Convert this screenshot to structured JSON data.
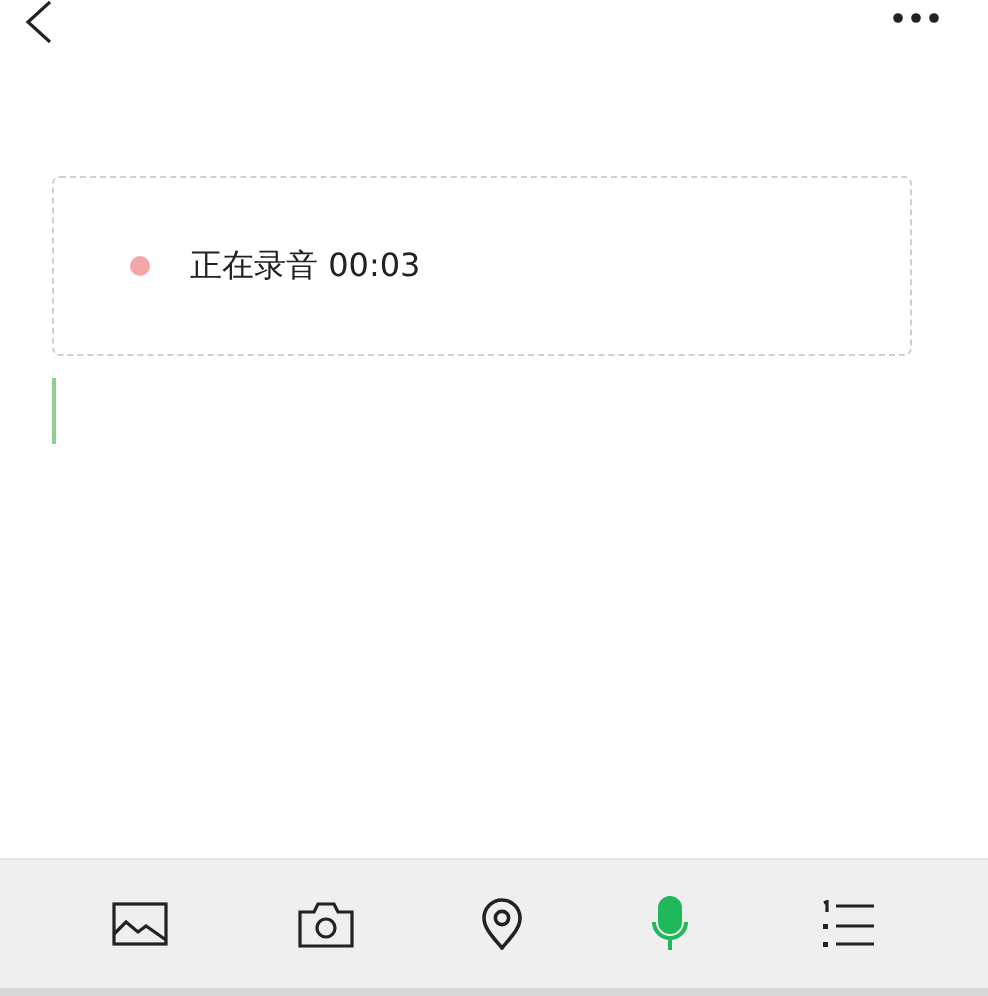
{
  "recording": {
    "label": "正在录音 00:03",
    "color": "#f4a7a9"
  },
  "toolbar": [
    {
      "kind": "image",
      "selected": false
    },
    {
      "kind": "camera",
      "selected": false
    },
    {
      "kind": "location",
      "selected": false
    },
    {
      "kind": "mic",
      "selected": true
    },
    {
      "kind": "list",
      "selected": false
    }
  ]
}
